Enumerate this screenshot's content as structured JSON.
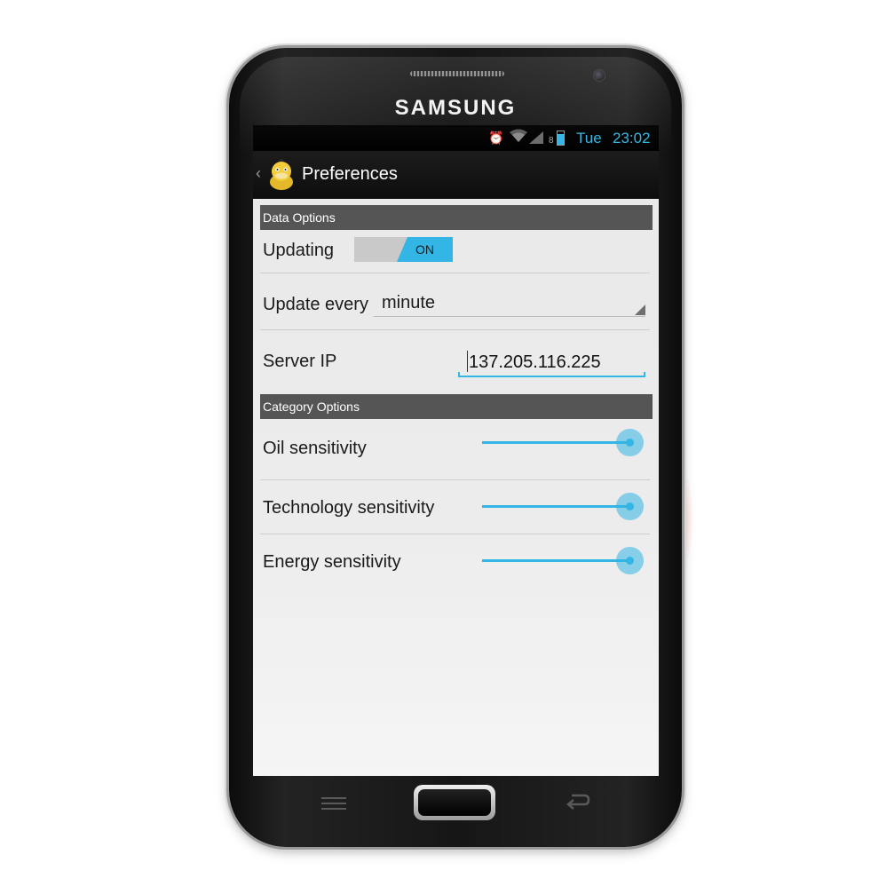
{
  "device": {
    "brand": "SAMSUNG"
  },
  "status_bar": {
    "icons": [
      "alarm-icon",
      "wifi-icon",
      "signal-icon",
      "battery-icon"
    ],
    "day": "Tue",
    "time": "23:02",
    "accent_color": "#33b5e5"
  },
  "action_bar": {
    "title": "Preferences",
    "app_icon": "duck-app-icon"
  },
  "sections": {
    "data_options": {
      "header": "Data Options",
      "updating": {
        "label": "Updating",
        "toggle_text": "ON",
        "state": "on"
      },
      "update_every": {
        "label": "Update every",
        "selected": "minute"
      },
      "server_ip": {
        "label": "Server IP",
        "value": "137.205.116.225"
      }
    },
    "category_options": {
      "header": "Category Options",
      "oil": {
        "label": "Oil sensitivity",
        "value": 1.0
      },
      "technology": {
        "label": "Technology sensitivity",
        "value": 1.0
      },
      "energy": {
        "label": "Energy sensitivity",
        "value": 1.0
      }
    }
  },
  "hardware_keys": [
    "menu-key",
    "home-key",
    "back-key"
  ]
}
